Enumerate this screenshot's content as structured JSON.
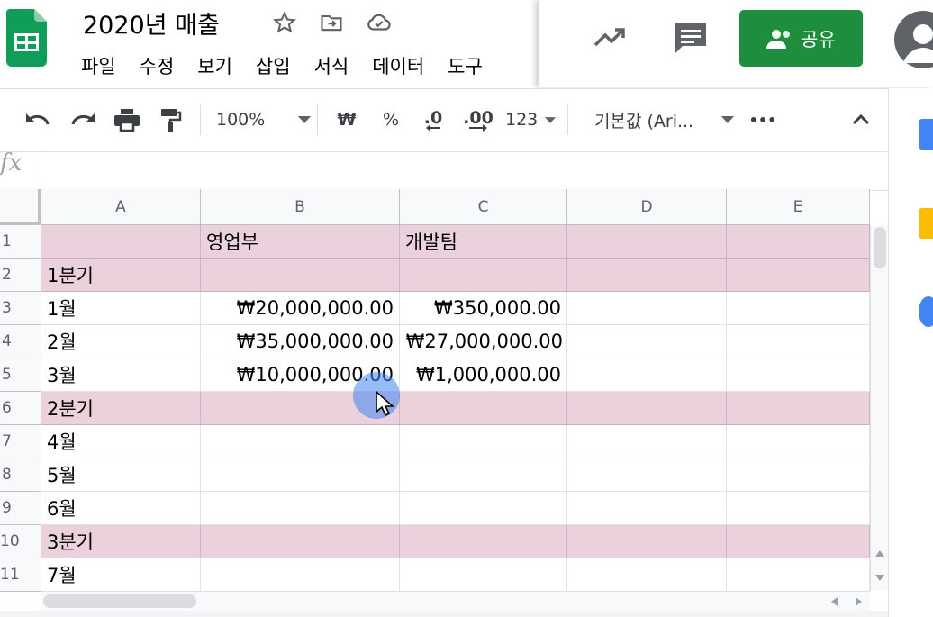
{
  "doc": {
    "title": "2020년 매출"
  },
  "menu": [
    "파일",
    "수정",
    "보기",
    "삽입",
    "서식",
    "데이터",
    "도구"
  ],
  "share_label": "공유",
  "toolbar": {
    "zoom": "100%",
    "currency": "₩",
    "percent": "%",
    "dec_decrease": ".0",
    "dec_increase": ".00",
    "number_format": "123",
    "font": "기본값 (Ari...",
    "more": "•••"
  },
  "formula_bar": {
    "fx_label": "fx",
    "value": ""
  },
  "columns": [
    "A",
    "B",
    "C",
    "D",
    "E"
  ],
  "rows": [
    {
      "num": "1",
      "band": true,
      "cells": [
        "",
        "영업부",
        "개발팀",
        "",
        ""
      ]
    },
    {
      "num": "2",
      "band": true,
      "cells": [
        "1분기",
        "",
        "",
        "",
        ""
      ]
    },
    {
      "num": "3",
      "band": false,
      "cells": [
        "1월",
        "₩20,000,000.00",
        "₩350,000.00",
        "",
        ""
      ]
    },
    {
      "num": "4",
      "band": false,
      "cells": [
        "2월",
        "₩35,000,000.00",
        "₩27,000,000.00",
        "",
        ""
      ]
    },
    {
      "num": "5",
      "band": false,
      "cells": [
        "3월",
        "₩10,000,000.00",
        "₩1,000,000.00",
        "",
        ""
      ]
    },
    {
      "num": "6",
      "band": true,
      "cells": [
        "2분기",
        "",
        "",
        "",
        ""
      ]
    },
    {
      "num": "7",
      "band": false,
      "cells": [
        "4월",
        "",
        "",
        "",
        ""
      ]
    },
    {
      "num": "8",
      "band": false,
      "cells": [
        "5월",
        "",
        "",
        "",
        ""
      ]
    },
    {
      "num": "9",
      "band": false,
      "cells": [
        "6월",
        "",
        "",
        "",
        ""
      ]
    },
    {
      "num": "10",
      "band": true,
      "cells": [
        "3분기",
        "",
        "",
        "",
        ""
      ]
    },
    {
      "num": "11",
      "band": false,
      "cells": [
        "7월",
        "",
        "",
        "",
        ""
      ]
    }
  ],
  "colors": {
    "band": "#ead1dc",
    "share": "#1e8e3e"
  }
}
